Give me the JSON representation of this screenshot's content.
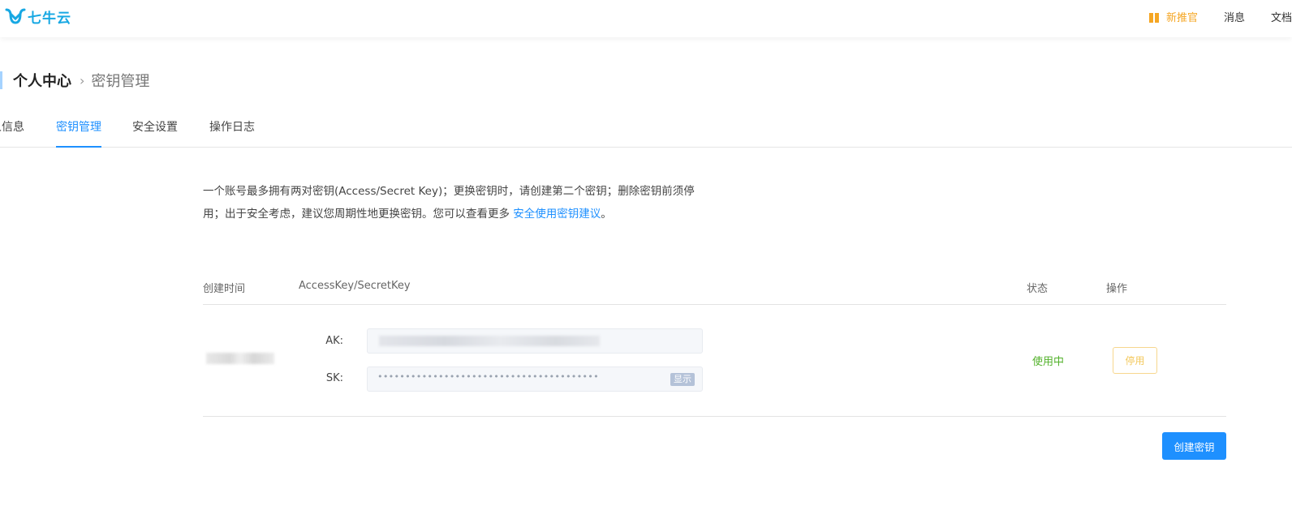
{
  "header": {
    "logo_text": "七牛云",
    "promo_label": "新推官",
    "messages_label": "消息",
    "docs_label": "文档"
  },
  "breadcrumb": {
    "root": "个人中心",
    "separator": "›",
    "current": "密钥管理"
  },
  "tabs": [
    {
      "label": "人信息",
      "active": false
    },
    {
      "label": "密钥管理",
      "active": true
    },
    {
      "label": "安全设置",
      "active": false
    },
    {
      "label": "操作日志",
      "active": false
    }
  ],
  "description": {
    "line1": "一个账号最多拥有两对密钥(Access/Secret Key)；更换密钥时，请创建第二个密钥；删除密钥前须停",
    "line2": "用；出于安全考虑，建议您周期性地更换密钥。您可以查看更多 ",
    "link": "安全使用密钥建议",
    "period": "。"
  },
  "table": {
    "columns": [
      "创建时间",
      "AccessKey/SecretKey",
      "状态",
      "操作"
    ],
    "rows": [
      {
        "ak_label": "AK:",
        "sk_label": "SK:",
        "sk_masked": "••••••••••••••••••••••••••••••••••••••••",
        "show_label": "显示",
        "status": "使用中",
        "action_label": "停用"
      }
    ]
  },
  "create_button": "创建密钥",
  "colors": {
    "brand": "#17a8e3",
    "accent": "#1e90ff",
    "promo": "#f5a623",
    "status_active": "#52b12a",
    "disable_border": "#f7d78e"
  }
}
